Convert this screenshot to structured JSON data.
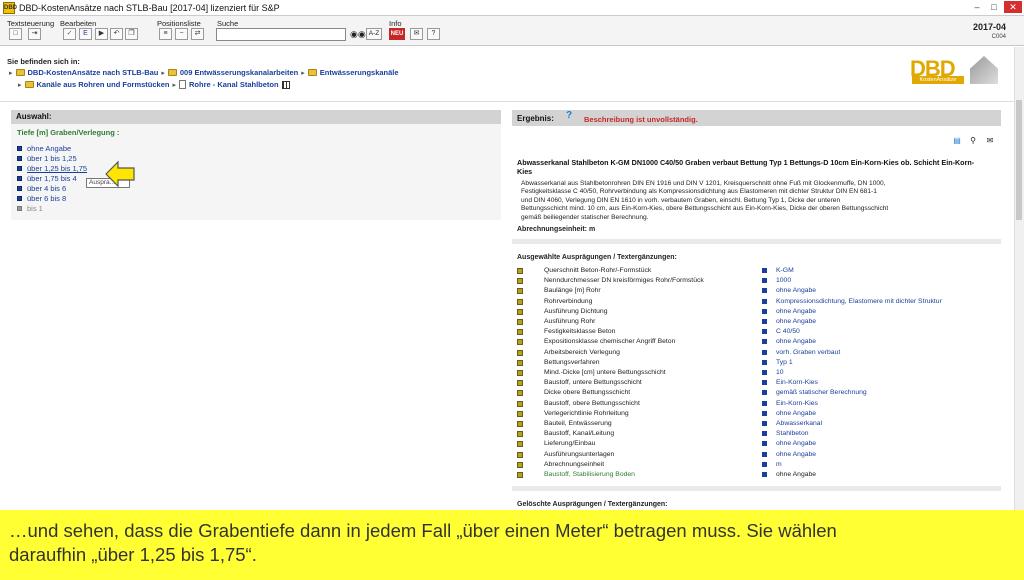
{
  "window": {
    "title": "DBD-KostenAnsätze nach STLB-Bau [2017-04] lizenziert für S&P",
    "app_icon_text": "DBD"
  },
  "menu": {
    "textsteuerung": "Textsteuerung",
    "bearbeiten": "Bearbeiten",
    "positionsliste": "Positionsliste",
    "suche": "Suche",
    "info": "Info",
    "az_label": "A-Z",
    "neu_label": "NEU"
  },
  "version": {
    "main": "2017-04",
    "sub": "C004"
  },
  "breadcrumb": {
    "title": "Sie befinden sich in:",
    "items": [
      "DBD-KostenAnsätze nach STLB-Bau",
      "009 Entwässerungskanalarbeiten",
      "Entwässerungskanäle",
      "Kanäle aus Rohren und Formstücken",
      "Rohre - Kanal Stahlbeton"
    ]
  },
  "logo": {
    "text": "DBD",
    "sub": "KostenAnsätze"
  },
  "auswahl": {
    "header": "Auswahl:",
    "title": "Tiefe [m] Graben/Verlegung :",
    "options": [
      "ohne Angabe",
      "über 1 bis 1,25",
      "über 1,25 bis 1,75",
      "über 1,75 bis 4",
      "über 4 bis 6",
      "über 6 bis 8",
      "bis 1"
    ],
    "tooltip": "Auspra..."
  },
  "ergebnis": {
    "header": "Ergebnis:",
    "warning": "Beschreibung ist unvollständig.",
    "title": "Abwasserkanal Stahlbeton K-GM DN1000 C40/50 Graben verbaut Bettung Typ 1 Bettungs-D 10cm Ein-Korn-Kies ob. Schicht Ein-Korn-Kies",
    "desc_lines": [
      "Abwasserkanal aus Stahlbetonrohren DIN EN 1916 und DIN V 1201, Kreisquerschnitt ohne Fuß mit Glockenmuffe, DN 1000,",
      "Festigkeitsklasse C 40/50, Rohrverbindung als Kompressionsdichtung aus Elastomeren mit dichter Struktur DIN EN 681-1",
      "und DIN 4060, Verlegung DIN EN 1610 in vorh. verbautem Graben, einschl. Bettung Typ 1, Dicke der unteren",
      "Bettungsschicht mind. 10 cm, aus Ein-Korn-Kies, obere Bettungsschicht aus Ein-Korn-Kies, Dicke der oberen Bettungsschicht",
      "gemäß beiliegender statischer Berechnung."
    ],
    "abrechnung": "Abrechnungseinheit: m"
  },
  "auspraegungen": {
    "header": "Ausgewählte Ausprägungen / Textergänzungen:",
    "rows": [
      {
        "label": "Querschnitt Beton-Rohr/-Formstück",
        "value": "K-GM"
      },
      {
        "label": "Nenndurchmesser DN kreisförmiges Rohr/Formstück",
        "value": "1000"
      },
      {
        "label": "Baulänge [m] Rohr",
        "value": "ohne Angabe"
      },
      {
        "label": "Rohrverbindung",
        "value": "Kompressionsdichtung, Elastomere mit dichter Struktur"
      },
      {
        "label": "Ausführung Dichtung",
        "value": "ohne Angabe"
      },
      {
        "label": "Ausführung Rohr",
        "value": "ohne Angabe"
      },
      {
        "label": "Festigkeitsklasse Beton",
        "value": "C 40/50"
      },
      {
        "label": "Expositionsklasse chemischer Angriff Beton",
        "value": "ohne Angabe"
      },
      {
        "label": "Arbeitsbereich Verlegung",
        "value": "vorh. Graben verbaut"
      },
      {
        "label": "Bettungsverfahren",
        "value": "Typ 1"
      },
      {
        "label": "Mind.-Dicke [cm] untere Bettungsschicht",
        "value": "10"
      },
      {
        "label": "Baustoff, untere Bettungsschicht",
        "value": "Ein-Korn-Kies"
      },
      {
        "label": "Dicke obere Bettungsschicht",
        "value": "gemäß statischer Berechnung"
      },
      {
        "label": "Baustoff, obere Bettungsschicht",
        "value": "Ein-Korn-Kies"
      },
      {
        "label": "Verlegerichtlinie Rohrleitung",
        "value": "ohne Angabe"
      },
      {
        "label": "Bauteil, Entwässerung",
        "value": "Abwasserkanal"
      },
      {
        "label": "Baustoff, Kanal/Leitung",
        "value": "Stahlbeton"
      },
      {
        "label": "Lieferung/Einbau",
        "value": "ohne Angabe"
      },
      {
        "label": "Ausführungsunterlagen",
        "value": "ohne Angabe"
      },
      {
        "label": "Abrechnungseinheit",
        "value": "m"
      },
      {
        "label": "Baustoff, Stabilisierung Boden",
        "value": "ohne Angabe"
      }
    ]
  },
  "geloeschte": {
    "header": "Gelöschte Ausprägungen / Textergänzungen:"
  },
  "caption": {
    "line1": "…und sehen, dass die  Grabentiefe dann in jedem Fall „über einen Meter“  betragen muss. Sie wählen",
    "line2": "daraufhin „über 1,25 bis 1,75“."
  }
}
